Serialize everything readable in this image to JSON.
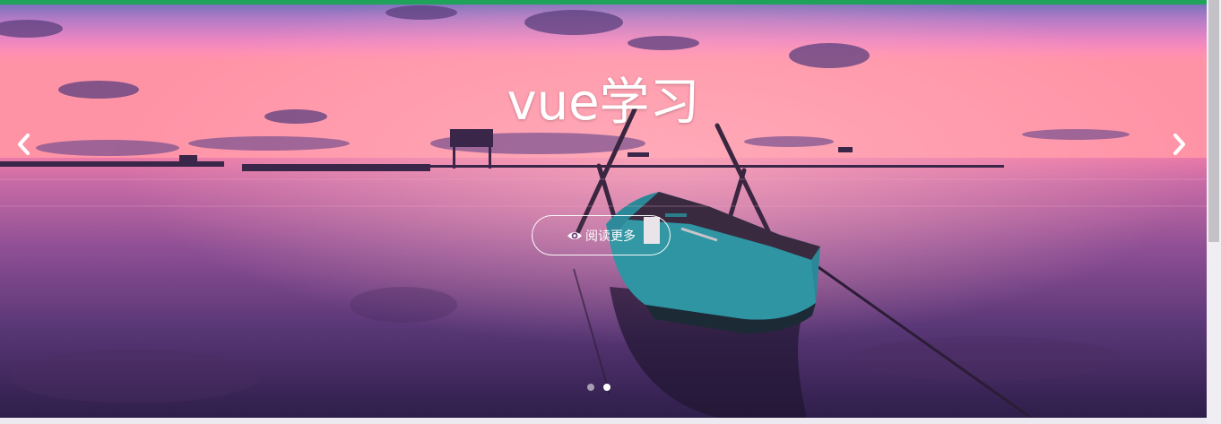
{
  "carousel": {
    "caption": {
      "title": "vue学习",
      "read_more_label": "阅读更多"
    },
    "prev_icon": "chevron-left-icon",
    "next_icon": "chevron-right-icon",
    "read_more_icon": "eye-icon",
    "slide_count": 2,
    "active_slide": 2,
    "colors": {
      "accent_bar": "#1fa35a",
      "sky_top": "#5a6fb8",
      "sky_pink": "#ff7aa8",
      "water_dark": "#2e1d48",
      "boat_hull": "#2f8c9a"
    }
  },
  "scrollbar": {
    "position_fraction": 0.0,
    "visible_fraction": 0.57
  }
}
